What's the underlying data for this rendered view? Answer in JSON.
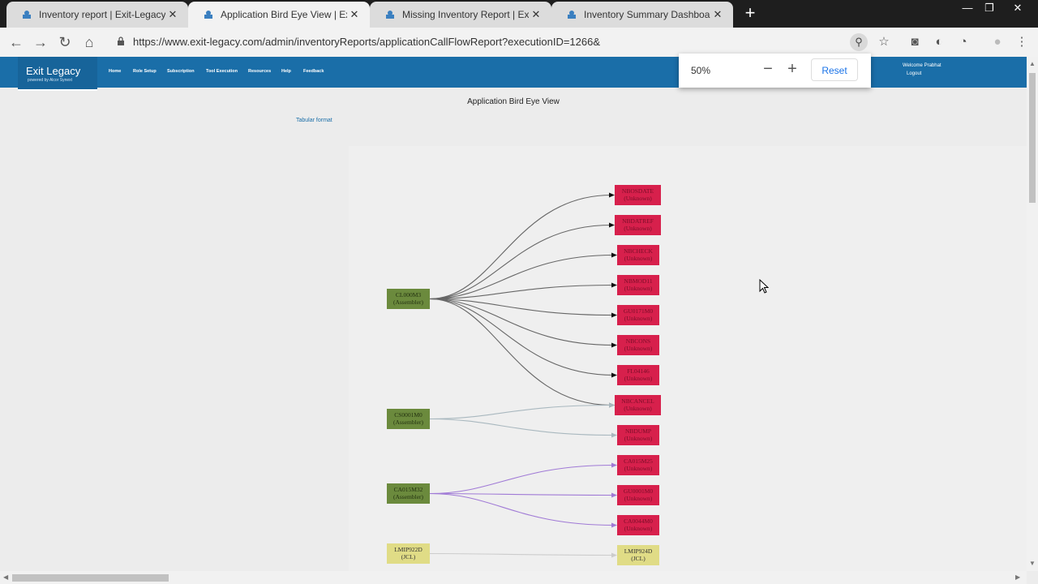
{
  "browser": {
    "tabs": [
      {
        "title": "Inventory report | Exit-Legacy",
        "close": "✕"
      },
      {
        "title": "Application Bird Eye View | Exit-L",
        "close": "✕"
      },
      {
        "title": "Missing Inventory Report | Exit-L",
        "close": "✕"
      },
      {
        "title": "Inventory Summary Dashboard |",
        "close": "✕"
      }
    ],
    "new_tab": "+",
    "window_controls": {
      "minimize": "—",
      "restore": "❐",
      "close": "✕"
    },
    "back": "←",
    "forward": "→",
    "reload": "↻",
    "home": "⌂",
    "lock": "🔒",
    "url": "https://www.exit-legacy.com/admin/inventoryReports/applicationCallFlowReport?executionID=1266&",
    "zoom_icon": "⚲",
    "bookmark": "☆",
    "toolbar_icons": [
      "camera-icon",
      "circle-icon",
      "gauge-icon",
      "profile-icon",
      "menu-icon"
    ],
    "camera": "◙",
    "ext": "◐",
    "gauge": "◔",
    "profile": "●",
    "menu": "⋮"
  },
  "zoom_popup": {
    "level": "50%",
    "minus": "−",
    "plus": "+",
    "reset": "Reset"
  },
  "app": {
    "brand": "Exit Legacy",
    "brand_sub": "powered by Alcor Synext",
    "nav": [
      "Home",
      "Role Setup",
      "Subscription",
      "Tool Execution",
      "Resources",
      "Help",
      "Feedback"
    ],
    "welcome": "Welcome Prabhat",
    "logout": "Logout"
  },
  "page": {
    "title": "Application Bird Eye View",
    "tabular_link": "Tabular format"
  },
  "diagram": {
    "sources": [
      {
        "name": "CL000M3",
        "type": "(Assembler)",
        "color": "green"
      },
      {
        "name": "CS0001M0",
        "type": "(Assembler)",
        "color": "green"
      },
      {
        "name": "CA015M32",
        "type": "(Assembler)",
        "color": "green"
      },
      {
        "name": "LMIP922D",
        "type": "(JCL)",
        "color": "yellow"
      }
    ],
    "targets": [
      {
        "name": "NBOSDATE",
        "type": "(Unknown)",
        "color": "red"
      },
      {
        "name": "NBDATREF",
        "type": "(Unknown)",
        "color": "red"
      },
      {
        "name": "NBCHECK",
        "type": "(Unknown)",
        "color": "red"
      },
      {
        "name": "NBMOD11",
        "type": "(Unknown)",
        "color": "red"
      },
      {
        "name": "GU0171M0",
        "type": "(Unknown)",
        "color": "red"
      },
      {
        "name": "NBCONS",
        "type": "(Unknown)",
        "color": "red"
      },
      {
        "name": "FL04146",
        "type": "(Unknown)",
        "color": "red"
      },
      {
        "name": "NBCANCEL",
        "type": "(Unknown)",
        "color": "red"
      },
      {
        "name": "NBDUMP",
        "type": "(Unknown)",
        "color": "red"
      },
      {
        "name": "CA015M25",
        "type": "(Unknown)",
        "color": "red"
      },
      {
        "name": "GU0001M0",
        "type": "(Unknown)",
        "color": "red"
      },
      {
        "name": "CA0044M0",
        "type": "(Unknown)",
        "color": "red"
      },
      {
        "name": "LMIP924D",
        "type": "(JCL)",
        "color": "yellow"
      }
    ],
    "edges": [
      {
        "from": 0,
        "to": 0,
        "color": "#666666"
      },
      {
        "from": 0,
        "to": 1,
        "color": "#666666"
      },
      {
        "from": 0,
        "to": 2,
        "color": "#666666"
      },
      {
        "from": 0,
        "to": 3,
        "color": "#666666"
      },
      {
        "from": 0,
        "to": 4,
        "color": "#666666"
      },
      {
        "from": 0,
        "to": 5,
        "color": "#666666"
      },
      {
        "from": 0,
        "to": 6,
        "color": "#666666"
      },
      {
        "from": 0,
        "to": 7,
        "color": "#666666"
      },
      {
        "from": 1,
        "to": 7,
        "color": "#a9b8bf"
      },
      {
        "from": 1,
        "to": 8,
        "color": "#a9b8bf"
      },
      {
        "from": 2,
        "to": 9,
        "color": "#a07ad6"
      },
      {
        "from": 2,
        "to": 10,
        "color": "#a07ad6"
      },
      {
        "from": 2,
        "to": 11,
        "color": "#a07ad6"
      },
      {
        "from": 3,
        "to": 12,
        "color": "#cccccc"
      }
    ]
  },
  "colors": {
    "header": "#1a6ea8",
    "green_node": "#6b8a3d",
    "red_node": "#d7204c",
    "yellow_node": "#e0dc86"
  }
}
